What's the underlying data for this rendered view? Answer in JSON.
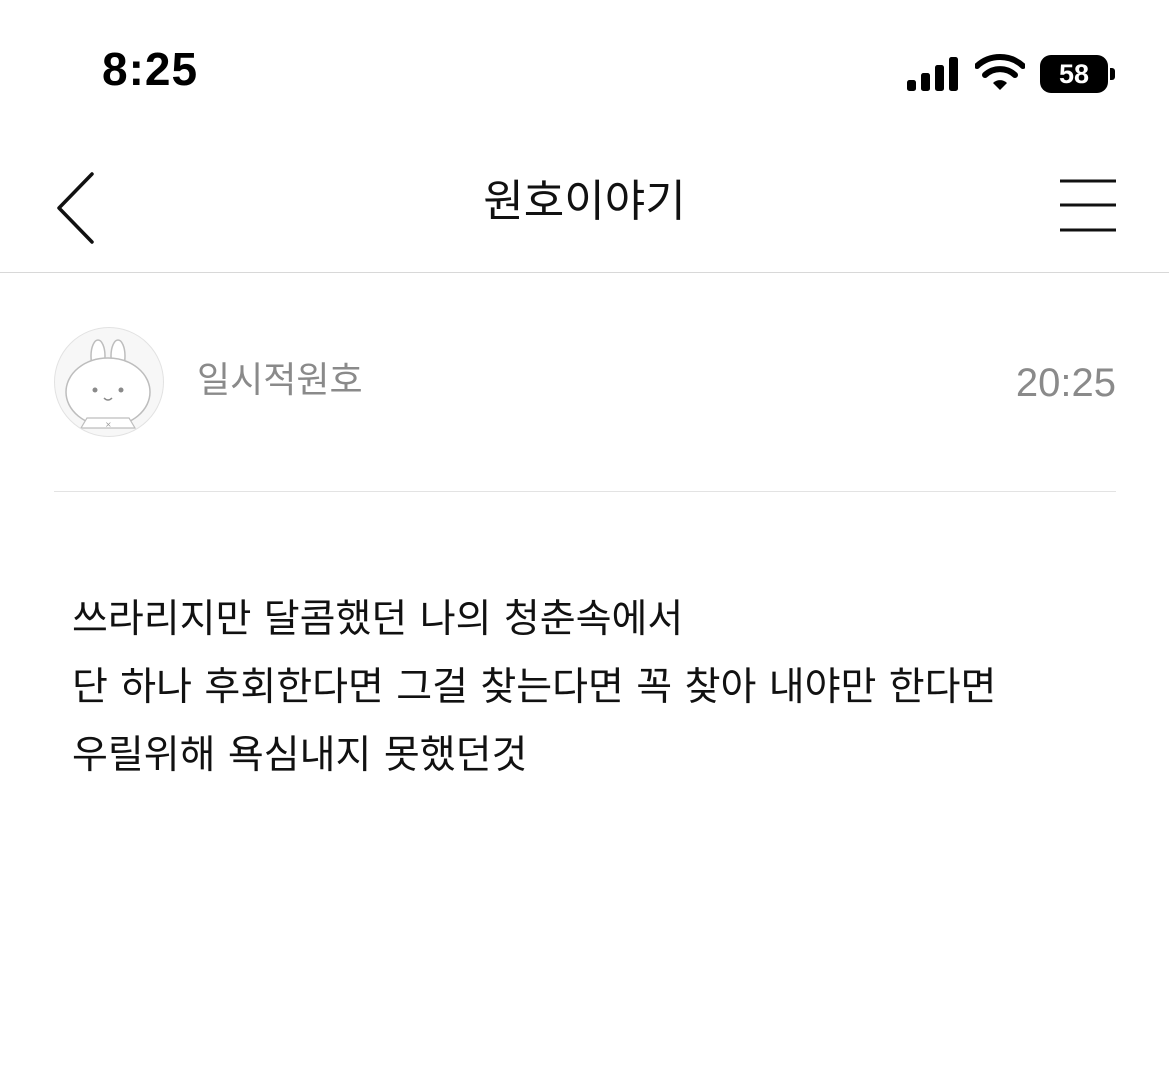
{
  "status_bar": {
    "time": "8:25",
    "battery": "58",
    "icons": [
      "cellular-signal-icon",
      "wifi-icon",
      "battery-icon"
    ]
  },
  "nav": {
    "title": "원호이야기",
    "back_icon": "chevron-left-icon",
    "menu_icon": "hamburger-menu-icon"
  },
  "post": {
    "author": "일시적원호",
    "time": "20:25",
    "avatar_icon": "bunny-avatar-icon",
    "lines": [
      "쓰라리지만 달콤했던 나의 청춘속에서",
      "단 하나 후회한다면 그걸 찾는다면 꼭 찾아 내야만 한다면",
      "우릴위해 욕심내지 못했던것"
    ]
  },
  "colors": {
    "text": "#111111",
    "meta": "#8a8a8a",
    "divider": "#d8d8d8",
    "background": "#ffffff"
  }
}
